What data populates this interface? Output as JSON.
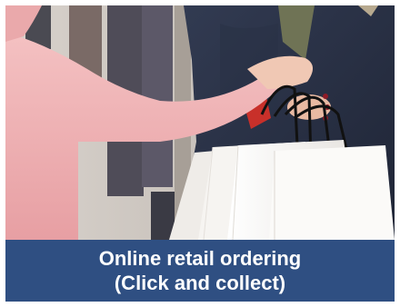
{
  "card": {
    "caption_line1": "Online retail ordering",
    "caption_line2": "(Click and collect)"
  },
  "colors": {
    "caption_band": "#2f4f82",
    "caption_text": "#ffffff",
    "sleeve_pink": "#f0b3b5",
    "coat_navy": "#2b3347",
    "bag_white": "#f4f2ef"
  },
  "photo": {
    "subject": "shopping-bags-handover-photo"
  }
}
